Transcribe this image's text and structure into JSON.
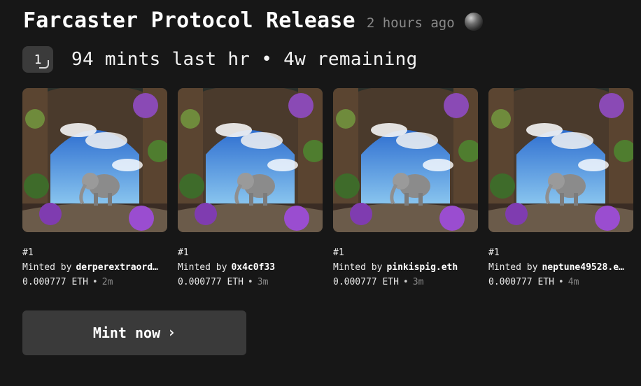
{
  "header": {
    "title": "Farcaster Protocol Release",
    "time_ago": "2 hours ago"
  },
  "stats": {
    "count_badge": "1",
    "text": "94 mints last hr • 4w remaining"
  },
  "mints": [
    {
      "token": "#1",
      "minted_by_label": "Minted by",
      "minter": "derperextraord…",
      "price": "0.000777 ETH",
      "dot": "•",
      "ago": "2m"
    },
    {
      "token": "#1",
      "minted_by_label": "Minted by",
      "minter": "0x4c0f33",
      "price": "0.000777 ETH",
      "dot": "•",
      "ago": "3m"
    },
    {
      "token": "#1",
      "minted_by_label": "Minted by",
      "minter": "pinkispig.eth",
      "price": "0.000777 ETH",
      "dot": "•",
      "ago": "3m"
    },
    {
      "token": "#1",
      "minted_by_label": "Minted by",
      "minter": "neptune49528.e…",
      "price": "0.000777 ETH",
      "dot": "•",
      "ago": "4m"
    }
  ],
  "actions": {
    "mint_label": "Mint now",
    "chevron": "›"
  },
  "icons": {
    "avatar": "avatar-orb-icon",
    "badge_corner": "corner-arrow-icon",
    "chevron": "chevron-right-icon"
  },
  "colors": {
    "background": "#171717",
    "button": "#3a3a3a",
    "muted_text": "#8a8a8a"
  }
}
